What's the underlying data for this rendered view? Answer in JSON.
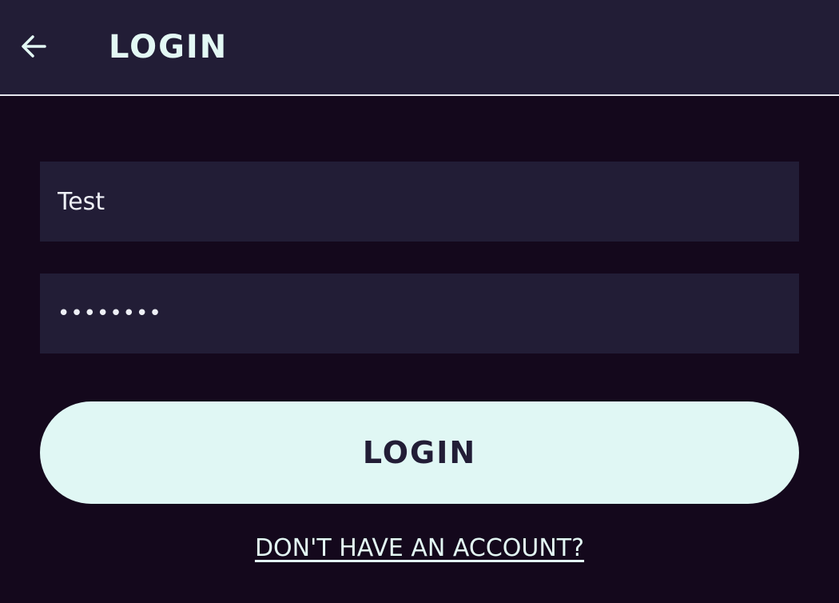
{
  "header": {
    "back_icon": "arrow-left-icon",
    "title": "LOGIN"
  },
  "form": {
    "username_value": "Test",
    "password_value": "••••••••",
    "login_label": "LOGIN",
    "signup_link": "Don't have an account?"
  },
  "colors": {
    "background": "#14081c",
    "header_bg": "#221d36",
    "field_bg": "#221d36",
    "accent": "#e0f7f4",
    "text": "#e3f8f4"
  }
}
